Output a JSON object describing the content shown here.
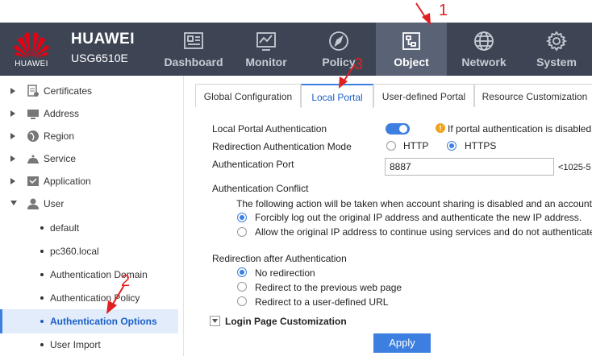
{
  "header": {
    "logo_text": "HUAWEI",
    "brand": "HUAWEI",
    "model": "USG6510E",
    "nav": [
      {
        "label": "Dashboard",
        "icon": "dashboard-icon"
      },
      {
        "label": "Monitor",
        "icon": "monitor-icon"
      },
      {
        "label": "Policy",
        "icon": "compass-icon"
      },
      {
        "label": "Object",
        "icon": "object-icon",
        "active": true
      },
      {
        "label": "Network",
        "icon": "globe-icon"
      },
      {
        "label": "System",
        "icon": "gear-icon"
      }
    ]
  },
  "sidebar": {
    "items": [
      {
        "label": "Certificates",
        "icon": "certificate-icon",
        "expanded": false
      },
      {
        "label": "Address",
        "icon": "address-icon",
        "expanded": false
      },
      {
        "label": "Region",
        "icon": "region-icon",
        "expanded": false
      },
      {
        "label": "Service",
        "icon": "service-icon",
        "expanded": false
      },
      {
        "label": "Application",
        "icon": "application-icon",
        "expanded": false
      },
      {
        "label": "User",
        "icon": "user-icon",
        "expanded": true
      }
    ],
    "children": [
      {
        "label": "default"
      },
      {
        "label": "pc360.local"
      },
      {
        "label": "Authentication Domain"
      },
      {
        "label": "Authentication Policy"
      },
      {
        "label": "Authentication Options",
        "selected": true
      },
      {
        "label": "User Import"
      }
    ]
  },
  "tabs": [
    {
      "label": "Global Configuration"
    },
    {
      "label": "Local Portal",
      "active": true
    },
    {
      "label": "User-defined Portal"
    },
    {
      "label": "Resource Customization"
    }
  ],
  "form": {
    "local_portal_auth_label": "Local Portal Authentication",
    "local_portal_auth_on": true,
    "portal_warning": "If portal authentication is disabled,",
    "redirect_mode_label": "Redirection Authentication Mode",
    "redirect_mode_options": [
      "HTTP",
      "HTTPS"
    ],
    "redirect_mode_selected": "HTTPS",
    "auth_port_label": "Authentication Port",
    "auth_port_value": "8887",
    "auth_port_range": "<1025-5",
    "conflict_label": "Authentication Conflict",
    "conflict_desc": "The following action will be taken when account sharing is disabled and an account",
    "conflict_options": [
      "Forcibly log out the original IP address and authenticate the new IP address.",
      "Allow the original IP address to continue using services and do not authenticate"
    ],
    "conflict_selected": 0,
    "redirect_after_label": "Redirection after Authentication",
    "redirect_after_options": [
      "No redirection",
      "Redirect to the previous web page",
      "Redirect to a user-defined URL"
    ],
    "redirect_after_selected": 0,
    "login_page_label": "Login Page Customization",
    "apply_label": "Apply"
  },
  "annotations": {
    "a1": "1",
    "a2": "2",
    "a3": "3",
    "color": "#e02020"
  },
  "colors": {
    "topbar": "#3d4555",
    "active_nav": "#5a6275",
    "accent": "#3d7fe0",
    "logo_red": "#e60012",
    "warning": "#f0a31e"
  }
}
